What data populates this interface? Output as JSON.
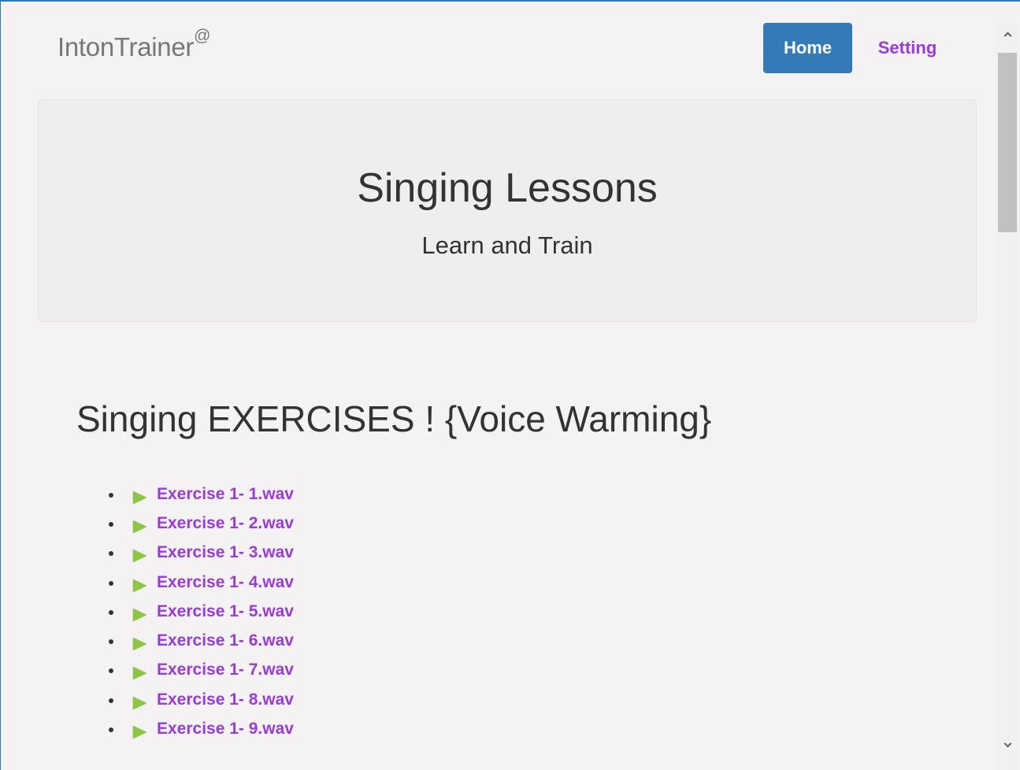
{
  "navbar": {
    "brand": "IntonTrainer",
    "brand_sup": "@",
    "home_label": "Home",
    "setting_label": "Setting"
  },
  "jumbotron": {
    "title": "Singing Lessons",
    "subtitle": "Learn and Train"
  },
  "exercises": {
    "heading": "Singing EXERCISES ! {Voice Warming}",
    "items": [
      {
        "label": "Exercise 1- 1.wav"
      },
      {
        "label": "Exercise 1- 2.wav"
      },
      {
        "label": "Exercise 1- 3.wav"
      },
      {
        "label": "Exercise 1- 4.wav"
      },
      {
        "label": "Exercise 1- 5.wav"
      },
      {
        "label": "Exercise 1- 6.wav"
      },
      {
        "label": "Exercise 1- 7.wav"
      },
      {
        "label": "Exercise 1- 8.wav"
      },
      {
        "label": "Exercise 1- 9.wav"
      }
    ]
  },
  "colors": {
    "accent": "#337ab7",
    "link": "#9b3bd6",
    "play_icon": "#8cc63f",
    "background": "#f4f2f3"
  },
  "icons": {
    "play": "play-icon",
    "scroll_up": "chevron-up-icon",
    "scroll_down": "chevron-down-icon"
  }
}
